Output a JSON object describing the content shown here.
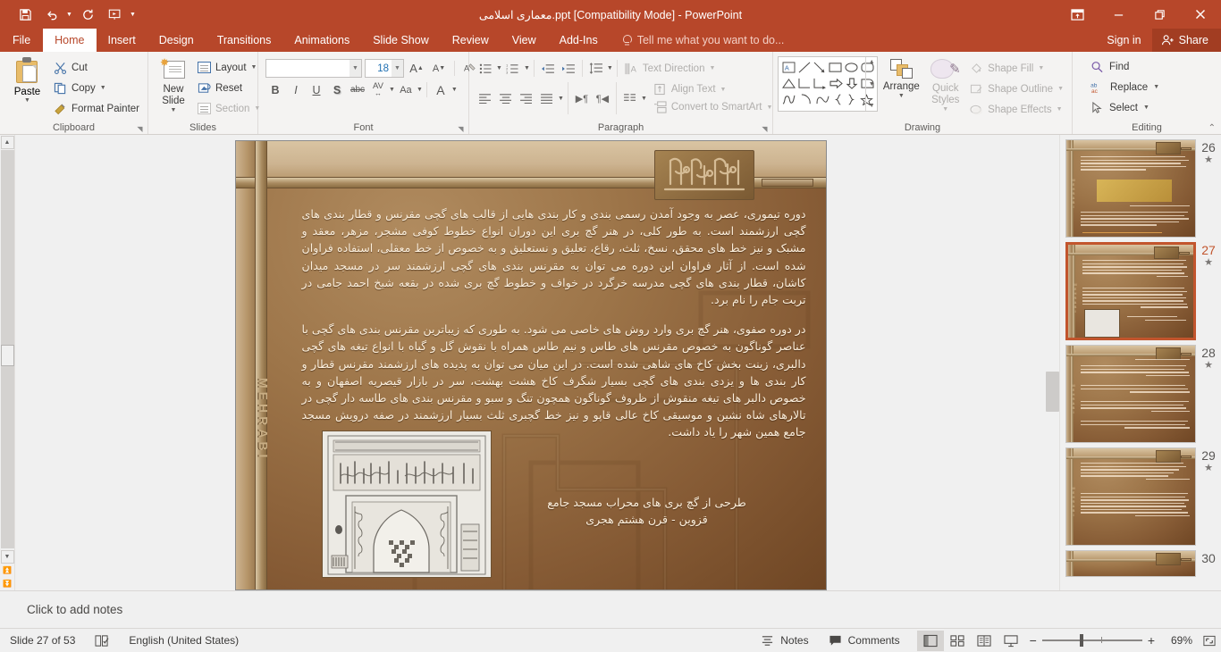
{
  "titlebar": {
    "document_title": "معماری اسلامی.ppt [Compatibility Mode] - PowerPoint",
    "qat": [
      {
        "name": "save",
        "glyph": "὚B"
      },
      {
        "name": "undo",
        "glyph": "↶"
      },
      {
        "name": "redo-repeat",
        "glyph": "↻"
      },
      {
        "name": "start-presentation",
        "glyph": "⎙"
      },
      {
        "name": "customize-qat",
        "glyph": "▾"
      }
    ],
    "window": {
      "ribbon_display_options": "❐",
      "minimize": "—",
      "restore": "❐",
      "close": "✕"
    }
  },
  "tabs": [
    {
      "label": "File",
      "active": false
    },
    {
      "label": "Home",
      "active": true
    },
    {
      "label": "Insert",
      "active": false
    },
    {
      "label": "Design",
      "active": false
    },
    {
      "label": "Transitions",
      "active": false
    },
    {
      "label": "Animations",
      "active": false
    },
    {
      "label": "Slide Show",
      "active": false
    },
    {
      "label": "Review",
      "active": false
    },
    {
      "label": "View",
      "active": false
    },
    {
      "label": "Add-Ins",
      "active": false
    }
  ],
  "tellme": {
    "placeholder": "Tell me what you want to do..."
  },
  "account": {
    "signin": "Sign in",
    "share": "Share"
  },
  "ribbon": {
    "clipboard": {
      "label": "Clipboard",
      "paste": "Paste",
      "cut": "Cut",
      "copy": "Copy",
      "format_painter": "Format Painter"
    },
    "slides": {
      "label": "Slides",
      "new_slide": "New Slide",
      "layout": "Layout",
      "reset": "Reset",
      "section": "Section"
    },
    "font": {
      "label": "Font",
      "font_name_value": "",
      "font_name_placeholder": "",
      "font_size_value": "18",
      "increase_font": "A",
      "decrease_font": "A",
      "clear_formatting": "A",
      "bold": "B",
      "italic": "I",
      "underline": "U",
      "shadow": "S",
      "strikethrough": "abc",
      "character_spacing": "AV",
      "change_case": "Aa",
      "font_color": "A"
    },
    "paragraph": {
      "label": "Paragraph",
      "text_direction": "Text Direction",
      "align_text": "Align Text",
      "convert_to_smartart": "Convert to SmartArt"
    },
    "drawing": {
      "label": "Drawing",
      "arrange": "Arrange",
      "quick_styles": "Quick Styles",
      "shape_fill": "Shape Fill",
      "shape_outline": "Shape Outline",
      "shape_effects": "Shape Effects"
    },
    "editing": {
      "label": "Editing",
      "find": "Find",
      "replace": "Replace",
      "select": "Select"
    }
  },
  "slide": {
    "vertical_word": "MEHRABI",
    "paragraph_1": "دوره تیموری، عصر به وجود آمدن رسمی بندی و کار بندی هایی از قالب های گچی مقرنس و قطار بندی های گچی ارزشمند است. به طور کلی، در هنر گچ بری این دوران انواع خطوط کوفی مشجر، مزهر، معقد و مشبک و نیز خط های محقق، نسخ، ثلث، رقاع، تعلیق و نستعلیق و به خصوص از خط معقلی، استفاده فراوان شده است. از آثار فراوان این دوره می توان به مقرنس بندی های گچی ارزشمند سر در مسجد میدان کاشان، قطار بندی های گچی مدرسه خرگرد در خواف و خطوط گچ بری شده در بقعه شیخ احمد جامی در تربت جام را نام برد.",
    "paragraph_2": "در دوره صفوی، هنر گچ بری وارد روش های خاصی می شود. به طوری که زیباترین مقرنس بندی های گچی با عناصر گوناگون به خصوص مقرنس های طاس و نیم طاس همراه با نقوش گل و گیاه با انواع تیغه های گچی دالبری، زینت بخش کاخ های شاهی شده است. در این میان می توان به پدیده های ارزشمند مقرنس قطار و کار بندی ها و یزدی بندی های گچی بسیار شگرف کاخ هشت بهشت، سر در بازار قیصریه اصفهان و به خصوص دالبر های تیغه منقوش از ظروف گوناگون همچون تنگ و سبو و مقرنس بندی های طاسه دار گچی در تالارهای شاه نشین و موسیقی کاخ عالی قاپو و نیز خط گچبری ثلث بسیار ارزشمند در صفه درویش مسجد جامع همین شهر را یاد داشت.",
    "caption": "طرحی از گچ بری های محراب مسجد جامع قزوین - قرن هشتم هجری",
    "photo_alt": "mihrab-stucco-drawing"
  },
  "thumbnails": [
    {
      "number": "26",
      "selected": false,
      "star": "★"
    },
    {
      "number": "27",
      "selected": true,
      "star": "★"
    },
    {
      "number": "28",
      "selected": false,
      "star": "★"
    },
    {
      "number": "29",
      "selected": false,
      "star": "★"
    },
    {
      "number": "30",
      "selected": false,
      "star": "★"
    }
  ],
  "notes": {
    "placeholder": "Click to add notes"
  },
  "statusbar": {
    "slide_indicator": "Slide 27 of 53",
    "language": "English (United States)",
    "notes_button": "Notes",
    "comments_button": "Comments",
    "zoom_percent": "69%",
    "views": [
      "normal-view",
      "slide-sorter-view",
      "reading-view",
      "slide-show-view"
    ]
  },
  "colors": {
    "accent": "#b7472a",
    "share_bg": "#a23d22",
    "selection_border": "#c2552d",
    "ribbon_bg": "#f4f3f2",
    "app_bg": "#f0f0f0"
  }
}
